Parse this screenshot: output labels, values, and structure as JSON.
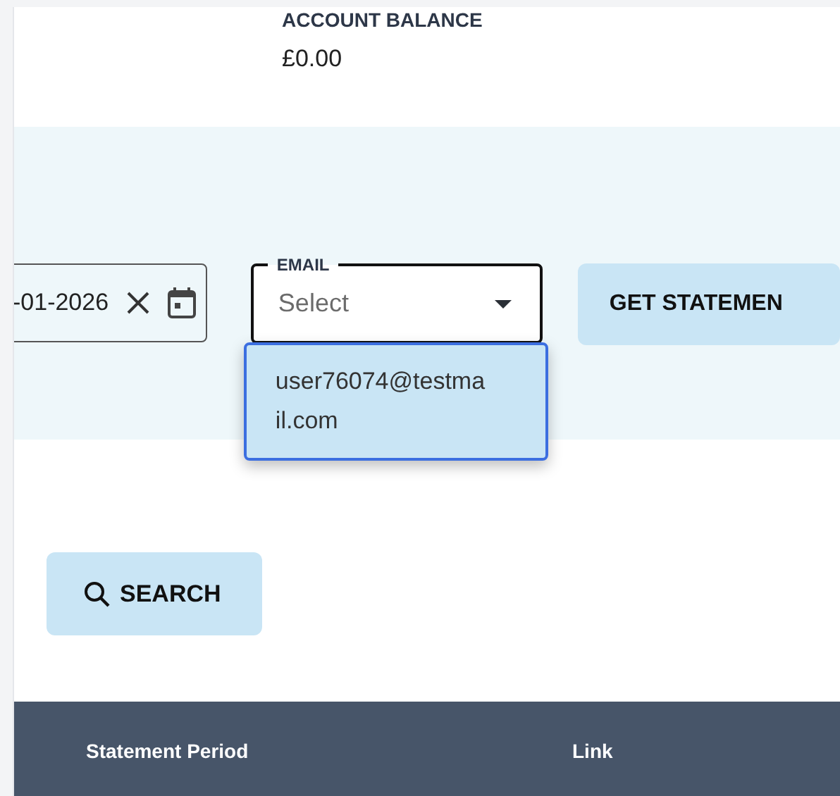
{
  "account_balance": {
    "label": "ACCOUNT BALANCE",
    "value": "£0.00"
  },
  "filters": {
    "date_field": {
      "value": "-01-2026"
    },
    "email_field": {
      "label": "EMAIL",
      "placeholder": "Select",
      "expanded": true,
      "options": [
        {
          "text": "user76074@testmail.com",
          "selected": true
        }
      ]
    },
    "get_button": {
      "label": "GET STATEMEN"
    }
  },
  "search_button": {
    "label": "SEARCH"
  },
  "table": {
    "columns": [
      "Statement Period",
      "Link"
    ]
  }
}
